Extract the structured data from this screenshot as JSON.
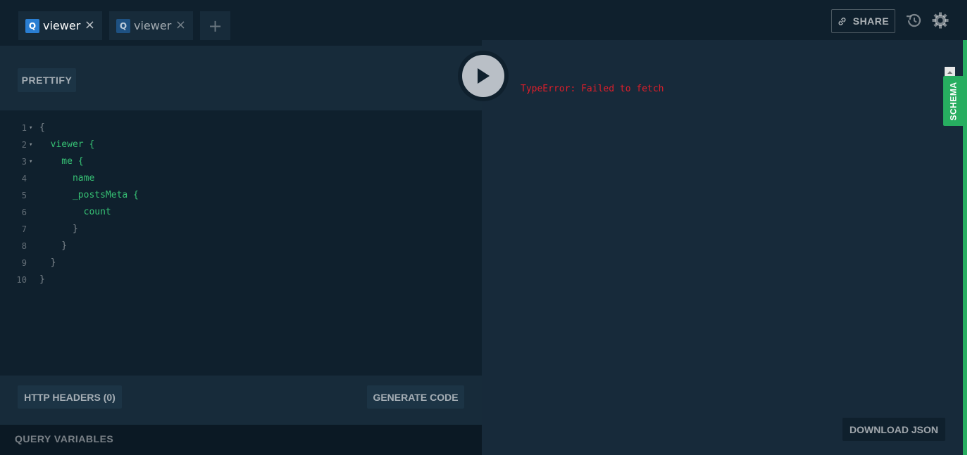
{
  "tabs": [
    {
      "badge": "Q",
      "label": "viewer",
      "close": "×"
    },
    {
      "badge": "Q",
      "label": "viewer",
      "close": "×"
    }
  ],
  "tab_add": "+",
  "topbar": {
    "share_label": "SHARE",
    "history_icon": "history-icon",
    "settings_icon": "gear-icon"
  },
  "editor": {
    "prettify_label": "PRETTIFY",
    "lines": [
      {
        "n": "1",
        "fold": "▾",
        "text": "{"
      },
      {
        "n": "2",
        "fold": "▾",
        "text": "  viewer {"
      },
      {
        "n": "3",
        "fold": "▾",
        "text": "    me {"
      },
      {
        "n": "4",
        "fold": "",
        "text": "      name"
      },
      {
        "n": "5",
        "fold": "",
        "text": "      _postsMeta {"
      },
      {
        "n": "6",
        "fold": "",
        "text": "        count"
      },
      {
        "n": "7",
        "fold": "",
        "text": "      }"
      },
      {
        "n": "8",
        "fold": "",
        "text": "    }"
      },
      {
        "n": "9",
        "fold": "",
        "text": "  }"
      },
      {
        "n": "10",
        "fold": "",
        "text": "}"
      }
    ],
    "http_headers_label": "HTTP HEADERS (0)",
    "generate_code_label": "GENERATE CODE",
    "query_variables_label": "QUERY VARIABLES"
  },
  "result": {
    "error_text": "TypeError: Failed to fetch",
    "download_label": "DOWNLOAD JSON"
  },
  "schema_label": "SCHEMA",
  "colors": {
    "background": "#172a3a",
    "accent_green": "#27ae60",
    "error_red": "#e01e2a",
    "keyword_green": "#36c074",
    "tab_badge_blue": "#2a7ed2"
  }
}
